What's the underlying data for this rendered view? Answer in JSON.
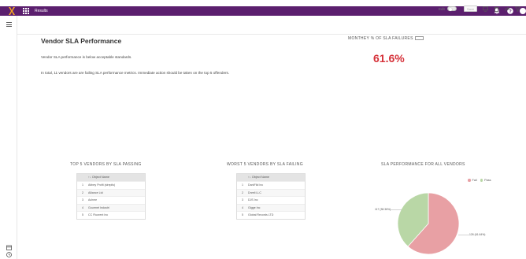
{
  "topbar": {
    "app_title": "Results",
    "bg_color": "#5b1f6e"
  },
  "toolbar": {
    "edit_label": "Edit",
    "save_label": "Save",
    "kpi_box_label": "..."
  },
  "header": {
    "title": "Vendor SLA Performance"
  },
  "summary": {
    "line1": "Vendor SLA performance is below acceptable standards.",
    "line2": "In total, 11 vendors are are failing SLA performance metrics. Immediate action should be taken on the top 5 offenders."
  },
  "kpi": {
    "title": "MONTHEY % OF SLA FAILURES",
    "value": "61.6%",
    "value_color": "#d6333b"
  },
  "top_passing": {
    "title": "TOP 5 VENDORS BY SLA PASSING",
    "header": "Object Name",
    "header_sort": "↑↓",
    "rows": [
      {
        "n": "1",
        "name": "Abbey Profit (slrepils)"
      },
      {
        "n": "2",
        "name": "Alliance Ltd"
      },
      {
        "n": "3",
        "name": "Achme"
      },
      {
        "n": "4",
        "name": "Gourmet Industri"
      },
      {
        "n": "5",
        "name": "CC Fluorent Inc"
      }
    ]
  },
  "worst_failing": {
    "title": "WORST 5 VENDORS BY SLA FAILING",
    "header": "Object Name",
    "header_sort": "↑↓",
    "rows": [
      {
        "n": "1",
        "name": "DarkFlid Inc"
      },
      {
        "n": "2",
        "name": "Dnreli LLC"
      },
      {
        "n": "3",
        "name": "DJS Inc"
      },
      {
        "n": "4",
        "name": "Gigge Inc"
      },
      {
        "n": "5",
        "name": "Global Records LTD"
      }
    ]
  },
  "chart_data": {
    "type": "pie",
    "title": "SLA PERFORMANCE FOR ALL VENDORS",
    "legend_position": "top-right",
    "slices": [
      {
        "label": "Fail",
        "value": 61.6,
        "color": "#e8a0a4",
        "annotation": "126 (61.64%)"
      },
      {
        "label": "Pass",
        "value": 38.4,
        "color": "#b9d7a6",
        "annotation": "117 (38.36%)"
      }
    ]
  }
}
